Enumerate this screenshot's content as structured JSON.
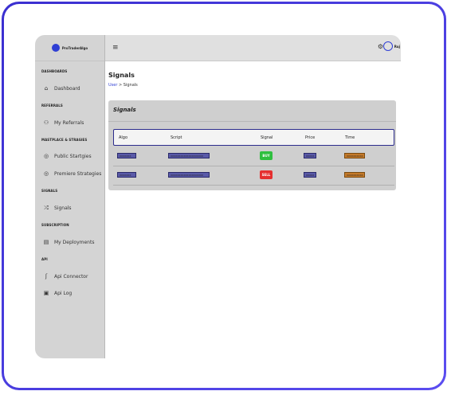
{
  "brand": {
    "logo_text": "ProTraderAlgo",
    "accent": "#2f3fd4"
  },
  "sidebar": {
    "sections": [
      {
        "title": "DASHBOARDS",
        "items": [
          {
            "label": "Dashboard",
            "icon": "home-icon"
          }
        ]
      },
      {
        "title": "REFERRALS",
        "items": [
          {
            "label": "My Referrals",
            "icon": "users-icon"
          }
        ]
      },
      {
        "title": "MASTPLACE & STRAGIES",
        "items": [
          {
            "label": "Public Startgies",
            "icon": "globe-icon"
          },
          {
            "label": "Premiere Strategies",
            "icon": "star-icon"
          }
        ]
      },
      {
        "title": "SIGNALS",
        "items": [
          {
            "label": "Signals",
            "icon": "shuffle-icon"
          }
        ]
      },
      {
        "title": "SUBSCRIPTION",
        "items": [
          {
            "label": "My Deployments",
            "icon": "document-icon"
          }
        ]
      },
      {
        "title": "API",
        "items": [
          {
            "label": "Api Connector",
            "icon": "plug-icon"
          },
          {
            "label": "Api Log",
            "icon": "log-icon"
          }
        ]
      }
    ]
  },
  "topbar": {
    "menu_icon": "hamburger-icon",
    "settings_icon": "gear-icon",
    "user_label": "Ruj"
  },
  "page": {
    "title": "Signals",
    "breadcrumb": {
      "link": "User",
      "separator": ">",
      "current": "Signals"
    }
  },
  "card": {
    "title": "Signals",
    "columns": [
      "Algo",
      "Script",
      "Signal",
      "Price",
      "Time"
    ],
    "rows": [
      {
        "algo": "XXXXXXX",
        "script": "XXXXXXXXXXXXXXXXXXXX",
        "signal": "BUY",
        "signal_color": "#2fbf3f",
        "price": "XXXXX",
        "time": "XXXXXXXXXX"
      },
      {
        "algo": "XXXXXXX",
        "script": "XXXXXXXXXXXXXXXXXXXX",
        "signal": "SELL",
        "signal_color": "#e53030",
        "price": "XXXXX",
        "time": "XXXXXXXXXX"
      }
    ]
  }
}
